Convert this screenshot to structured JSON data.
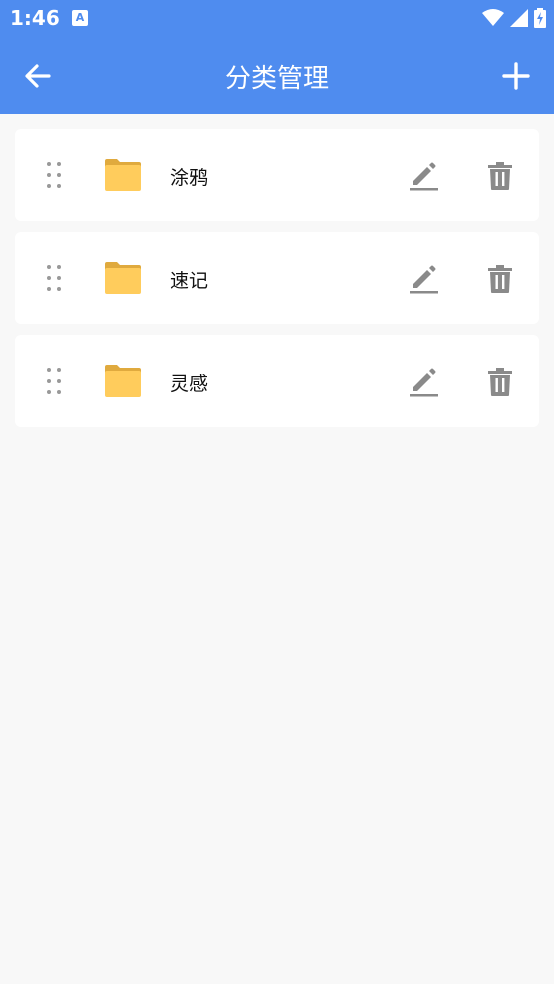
{
  "status_bar": {
    "time": "1:46",
    "notification_icon_letter": "A",
    "icons": [
      "wifi-icon",
      "signal-icon",
      "battery-charging-icon"
    ]
  },
  "app_bar": {
    "title": "分类管理",
    "back_icon": "arrow-left-icon",
    "add_icon": "plus-icon"
  },
  "colors": {
    "primary": "#4f8cef",
    "folder": "#ffcc5c",
    "icon_gray": "#8a8a8a",
    "background": "#f8f8f8"
  },
  "categories": [
    {
      "label": "涂鸦"
    },
    {
      "label": "速记"
    },
    {
      "label": "灵感"
    }
  ]
}
